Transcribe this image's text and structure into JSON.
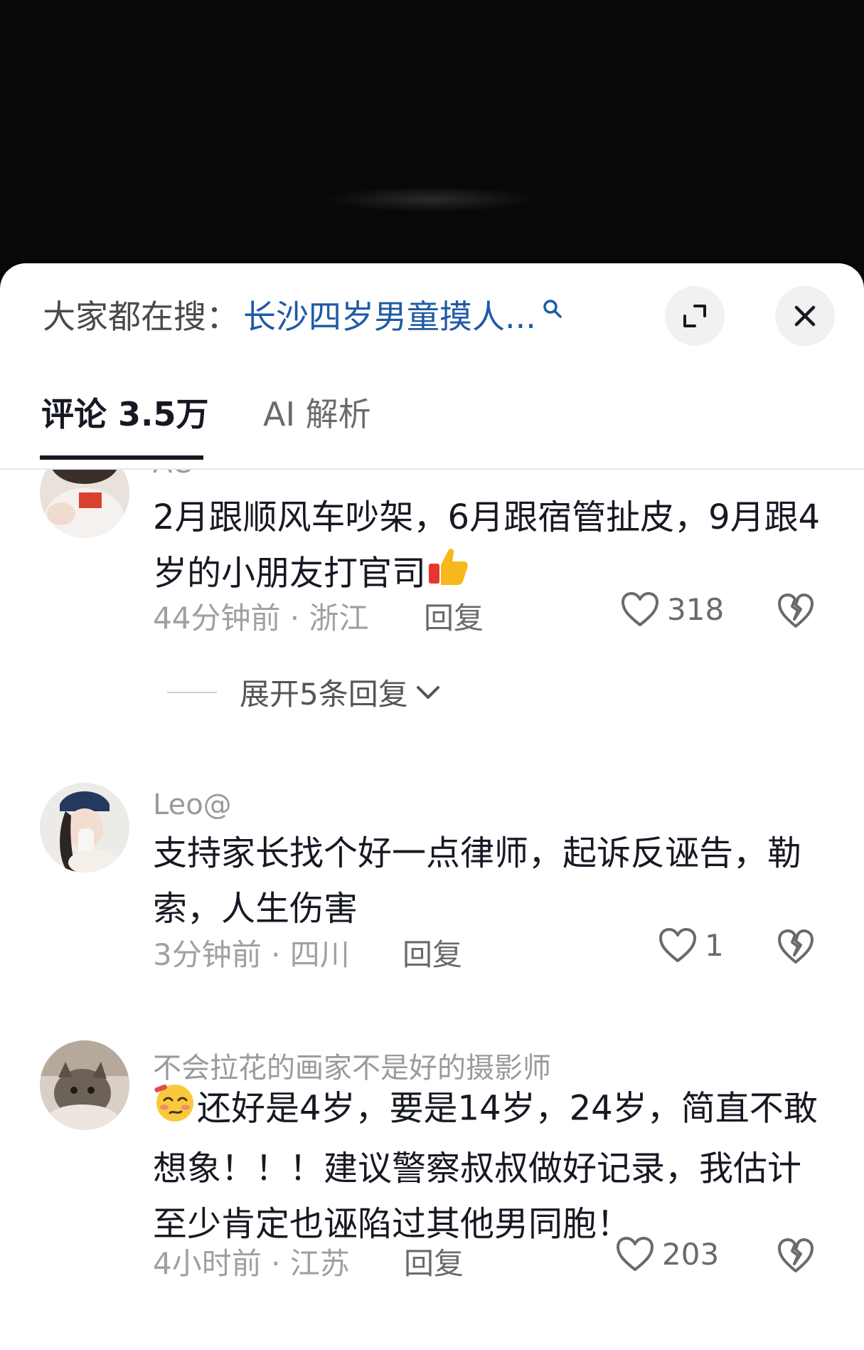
{
  "search": {
    "label": "大家都在搜：",
    "query": "长沙四岁男童摸人..."
  },
  "tabs": {
    "comments": "评论 3.5万",
    "ai": "AI 解析"
  },
  "comments": [
    {
      "username": "AC",
      "text": "2月跟顺风车吵架，6月跟宿管扯皮，9月跟4岁的小朋友打官司",
      "emoji": "thumbs-up",
      "meta": "44分钟前 · 浙江",
      "reply": "回复",
      "likes": "318",
      "expand": "展开5条回复"
    },
    {
      "username": "Leo@",
      "text": "支持家长找个好一点律师，起诉反诬告，勒索，人生伤害",
      "meta": "3分钟前 · 四川",
      "reply": "回复",
      "likes": "1"
    },
    {
      "username": "不会拉花的画家不是好的摄影师",
      "emoji": "woozy-face",
      "text": "还好是4岁，要是14岁，24岁，简直不敢想象！！！建议警察叔叔做好记录，我估计至少肯定也诬陷过其他男同胞！",
      "meta": "4小时前 · 江苏",
      "reply": "回复",
      "likes": "203"
    }
  ]
}
